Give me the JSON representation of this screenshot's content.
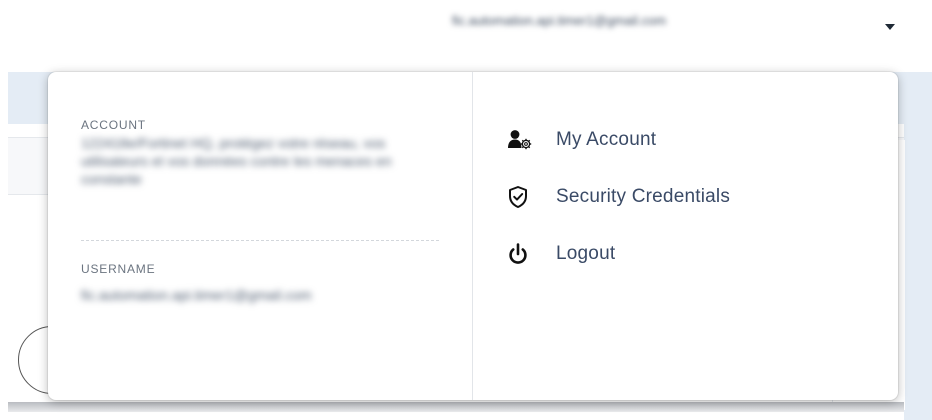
{
  "header": {
    "user_email": "fic.automation.api.timer1@gmail.com",
    "caret_icon": "caret-down-icon"
  },
  "dropdown": {
    "account_label": "ACCOUNT",
    "account_value": "122418e/Fortinet HQ, protégez votre réseau, vos utilisateurs et vos données contre les menaces en constante",
    "username_label": "USERNAME",
    "username_value": "fic.automation.api.timer1@gmail.com",
    "menu": [
      {
        "label": "My Account",
        "icon": "user-gear-icon"
      },
      {
        "label": "Security Credentials",
        "icon": "shield-check-icon"
      },
      {
        "label": "Logout",
        "icon": "power-icon"
      }
    ]
  }
}
